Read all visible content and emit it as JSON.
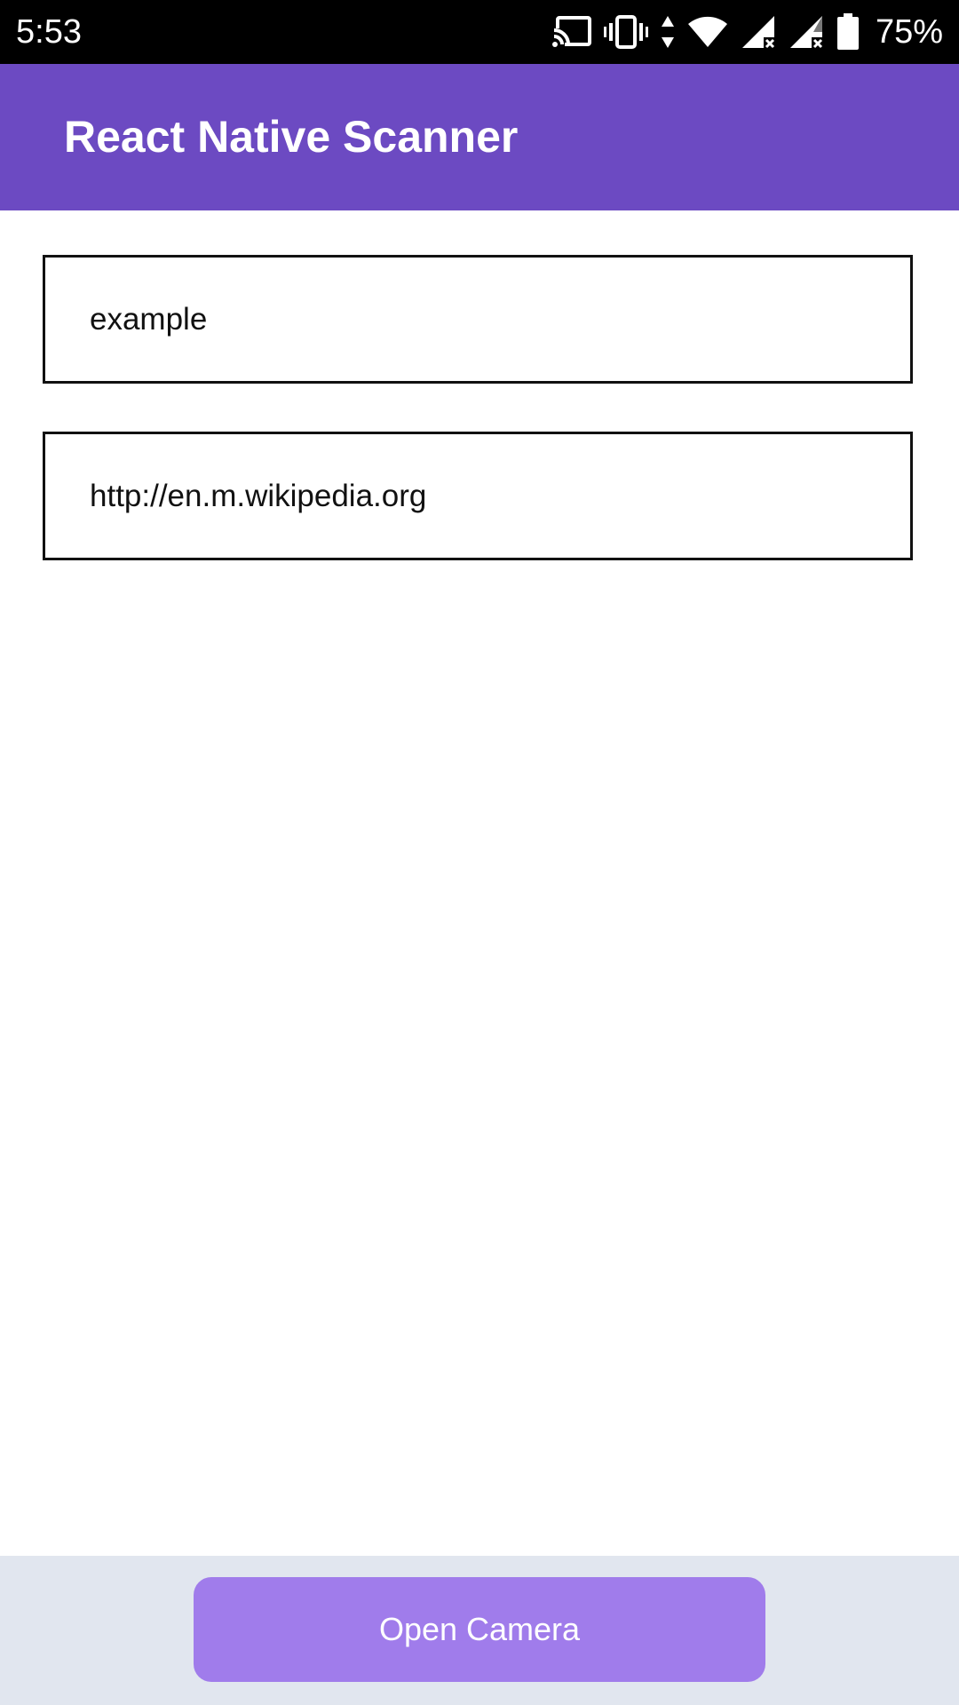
{
  "status_bar": {
    "time": "5:53",
    "battery_percent": "75%",
    "icons": [
      "cast-icon",
      "vibrate-icon",
      "data-arrows-icon",
      "wifi-icon",
      "signal-no-service-icon",
      "signal-no-service-icon",
      "battery-icon"
    ]
  },
  "header": {
    "title": "React Native Scanner",
    "background_color": "#6C4AC2"
  },
  "fields": {
    "first_value": "example",
    "second_value": "http://en.m.wikipedia.org"
  },
  "footer": {
    "background_color": "#E1E6EF",
    "button_label": "Open Camera",
    "button_color": "#A07CEB"
  }
}
